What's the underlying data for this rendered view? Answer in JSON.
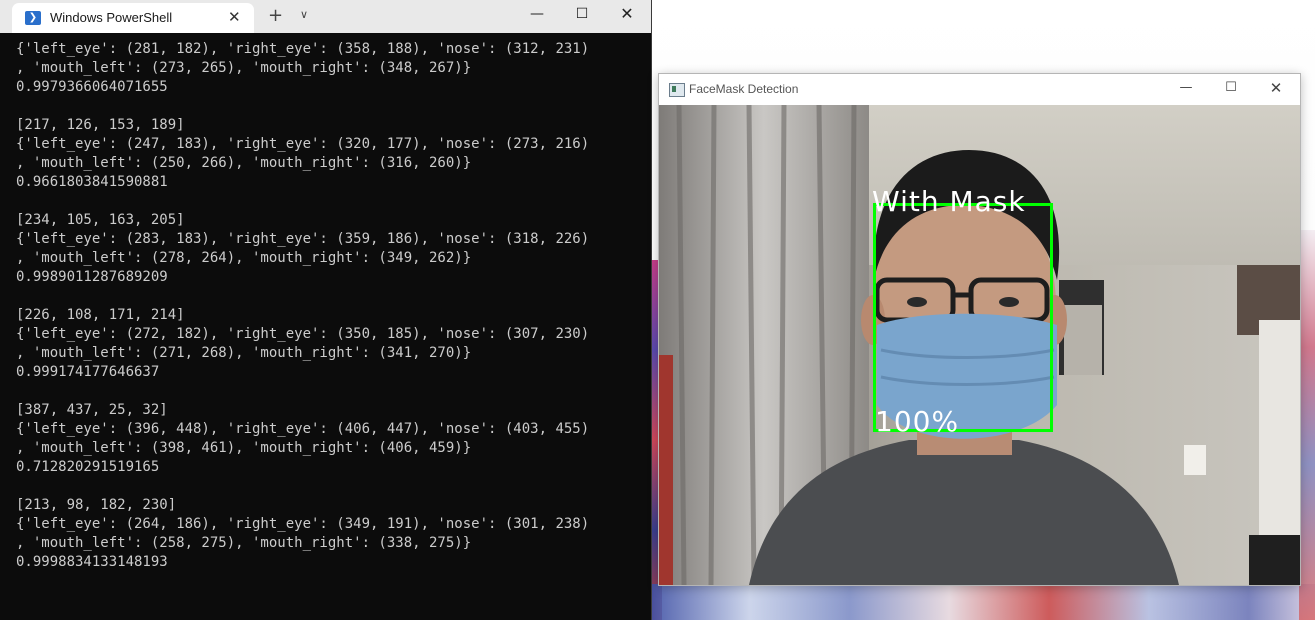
{
  "powershell": {
    "tab_title": "Windows PowerShell",
    "icons": {
      "app": "powershell-icon",
      "tab_close": "close-icon",
      "new_tab": "plus-icon",
      "dropdown": "chevron-down-icon",
      "minimize": "minimize-icon",
      "maximize": "maximize-icon",
      "close": "close-icon"
    },
    "console_lines": [
      "{'left_eye': (281, 182), 'right_eye': (358, 188), 'nose': (312, 231)",
      ", 'mouth_left': (273, 265), 'mouth_right': (348, 267)}",
      "0.9979366064071655",
      "",
      "[217, 126, 153, 189]",
      "{'left_eye': (247, 183), 'right_eye': (320, 177), 'nose': (273, 216)",
      ", 'mouth_left': (250, 266), 'mouth_right': (316, 260)}",
      "0.9661803841590881",
      "",
      "[234, 105, 163, 205]",
      "{'left_eye': (283, 183), 'right_eye': (359, 186), 'nose': (318, 226)",
      ", 'mouth_left': (278, 264), 'mouth_right': (349, 262)}",
      "0.9989011287689209",
      "",
      "[226, 108, 171, 214]",
      "{'left_eye': (272, 182), 'right_eye': (350, 185), 'nose': (307, 230)",
      ", 'mouth_left': (271, 268), 'mouth_right': (341, 270)}",
      "0.999174177646637",
      "",
      "[387, 437, 25, 32]",
      "{'left_eye': (396, 448), 'right_eye': (406, 447), 'nose': (403, 455)",
      ", 'mouth_left': (398, 461), 'mouth_right': (406, 459)}",
      "0.712820291519165",
      "",
      "[213, 98, 182, 230]",
      "{'left_eye': (264, 186), 'right_eye': (349, 191), 'nose': (301, 238)",
      ", 'mouth_left': (258, 275), 'mouth_right': (338, 275)}",
      "0.9998834133148193"
    ]
  },
  "facemask": {
    "window_title": "FaceMask Detection",
    "detection": {
      "label": "With Mask",
      "confidence": "100%",
      "box_color": "#00ff00",
      "text_color": "#ffffff"
    },
    "icons": {
      "app": "window-app-icon",
      "minimize": "minimize-icon",
      "maximize": "maximize-icon",
      "close": "close-icon"
    }
  },
  "colors": {
    "console_bg": "#0c0c0c",
    "console_text": "#cccccc",
    "ps_accent": "#2a6fcb"
  }
}
